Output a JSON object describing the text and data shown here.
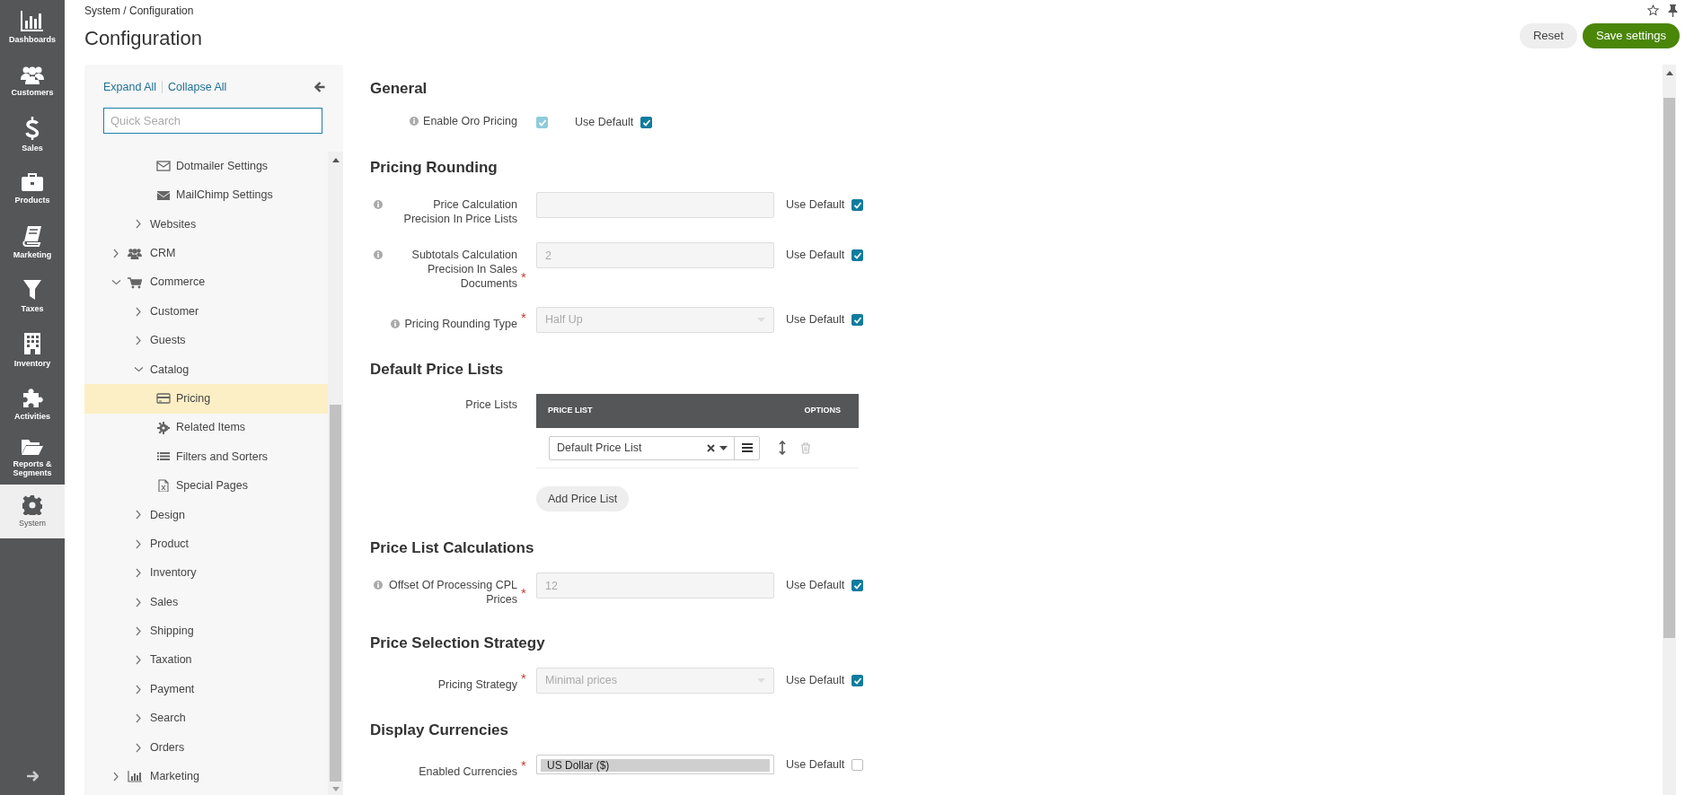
{
  "nav": {
    "items": [
      {
        "label": "Dashboards",
        "selected": false
      },
      {
        "label": "Customers",
        "selected": false
      },
      {
        "label": "Sales",
        "selected": false
      },
      {
        "label": "Products",
        "selected": false
      },
      {
        "label": "Marketing",
        "selected": false
      },
      {
        "label": "Taxes",
        "selected": false
      },
      {
        "label": "Inventory",
        "selected": false
      },
      {
        "label": "Activities",
        "selected": false
      },
      {
        "label": "Reports & Segments",
        "selected": false
      },
      {
        "label": "System",
        "selected": true
      }
    ]
  },
  "breadcrumb": "System / Configuration",
  "page_title": "Configuration",
  "actions": [
    {
      "label": "Reset",
      "kind": "secondary"
    },
    {
      "label": "Save settings",
      "kind": "primary"
    }
  ],
  "tree": {
    "expand_all": "Expand All",
    "collapse_all": "Collapse All",
    "search_placeholder": "Quick Search",
    "items": [
      {
        "children": [
          {
            "children": [
              {
                "label": "Dotmailer Settings",
                "selected": false
              },
              {
                "label": "MailChimp Settings",
                "selected": false
              }
            ]
          },
          {
            "label": "Websites",
            "expanded": false,
            "selected": false
          }
        ]
      },
      {
        "label": "CRM",
        "expanded": false,
        "selected": false
      },
      {
        "label": "Commerce",
        "expanded": true,
        "selected": false,
        "children": [
          {
            "label": "Customer",
            "expanded": false,
            "selected": false
          },
          {
            "label": "Guests",
            "expanded": false,
            "selected": false
          },
          {
            "label": "Catalog",
            "expanded": true,
            "selected": false,
            "children": [
              {
                "label": "Pricing",
                "selected": true
              },
              {
                "label": "Related Items",
                "selected": false
              },
              {
                "label": "Filters and Sorters",
                "selected": false
              },
              {
                "label": "Special Pages",
                "selected": false
              }
            ]
          },
          {
            "label": "Design",
            "expanded": false,
            "selected": false
          },
          {
            "label": "Product",
            "expanded": false,
            "selected": false
          },
          {
            "label": "Inventory",
            "expanded": false,
            "selected": false
          },
          {
            "label": "Sales",
            "expanded": false,
            "selected": false
          },
          {
            "label": "Shipping",
            "expanded": false,
            "selected": false
          },
          {
            "label": "Taxation",
            "expanded": false,
            "selected": false
          },
          {
            "label": "Payment",
            "expanded": false,
            "selected": false
          },
          {
            "label": "Search",
            "expanded": false,
            "selected": false
          },
          {
            "label": "Orders",
            "expanded": false,
            "selected": false
          }
        ]
      },
      {
        "label": "Marketing",
        "expanded": false,
        "selected": false
      }
    ]
  },
  "sections": [
    {
      "heading": "General",
      "fields": [
        {
          "kind": "checkbox",
          "label": "Enable Oro Pricing",
          "info": true,
          "checked": true,
          "disabled": true,
          "use_default_label": "Use Default",
          "use_default": true
        }
      ]
    },
    {
      "heading": "Pricing Rounding",
      "fields": [
        {
          "kind": "text",
          "label": "Price Calculation Precision In Price Lists",
          "info": true,
          "disabled": true,
          "use_default_label": "Use Default",
          "use_default": true
        },
        {
          "kind": "text",
          "label": "Subtotals Calculation Precision In Sales Documents",
          "info": true,
          "required_mark": "*",
          "value": "2",
          "disabled": true,
          "use_default_label": "Use Default",
          "use_default": true
        },
        {
          "kind": "select",
          "label": "Pricing Rounding Type",
          "info": true,
          "required_mark": "*",
          "value": "Half Up",
          "disabled": true,
          "use_default_label": "Use Default",
          "use_default": true
        }
      ]
    },
    {
      "heading": "Default Price Lists",
      "fields": [
        {
          "kind": "price_table",
          "label": "Price Lists",
          "info": false,
          "columns": [
            "PRICE LIST",
            "OPTIONS"
          ],
          "rows": [
            {
              "value": "Default Price List"
            }
          ],
          "add_button": "Add Price List"
        }
      ]
    },
    {
      "heading": "Price List Calculations",
      "fields": [
        {
          "kind": "text",
          "label": "Offset Of Processing CPL Prices",
          "info": true,
          "required_mark": "*",
          "value": "12",
          "disabled": true,
          "use_default_label": "Use Default",
          "use_default": true
        }
      ]
    },
    {
      "heading": "Price Selection Strategy",
      "fields": [
        {
          "kind": "select",
          "label": "Pricing Strategy",
          "info": false,
          "required_mark": "*",
          "value": "Minimal prices",
          "disabled": true,
          "use_default_label": "Use Default",
          "use_default": true
        }
      ]
    },
    {
      "heading": "Display Currencies",
      "fields": [
        {
          "kind": "multiselect",
          "label": "Enabled Currencies",
          "info": false,
          "required_mark": "*",
          "options": [
            {
              "label": "US Dollar ($)",
              "selected": true
            }
          ],
          "disabled": false,
          "use_default_label": "Use Default",
          "use_default": false
        }
      ]
    }
  ]
}
